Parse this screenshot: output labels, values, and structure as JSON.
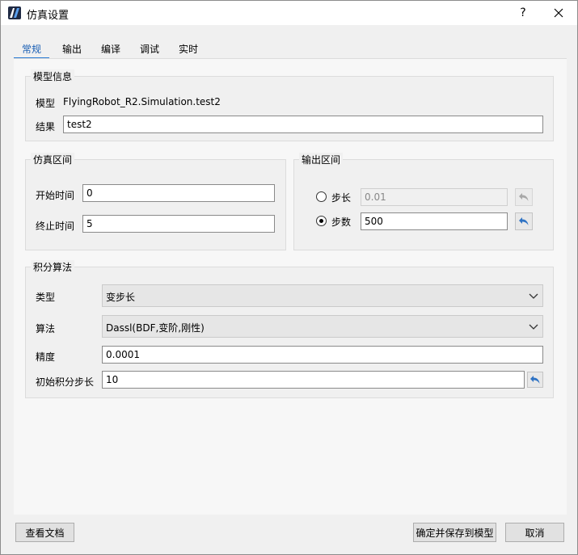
{
  "window": {
    "title": "仿真设置",
    "help_label": "?",
    "close_label": "✕"
  },
  "tabs": [
    {
      "label": "常规"
    },
    {
      "label": "输出"
    },
    {
      "label": "编译"
    },
    {
      "label": "调试"
    },
    {
      "label": "实时"
    }
  ],
  "model_info": {
    "title": "模型信息",
    "model_label": "模型",
    "model_value": "FlyingRobot_R2.Simulation.test2",
    "result_label": "结果",
    "result_value": "test2"
  },
  "sim_interval": {
    "title": "仿真区间",
    "start_label": "开始时间",
    "start_value": "0",
    "stop_label": "终止时间",
    "stop_value": "5"
  },
  "output_interval": {
    "title": "输出区间",
    "step_label": "步长",
    "step_value": "0.01",
    "count_label": "步数",
    "count_value": "500",
    "selected": "步数"
  },
  "integration": {
    "title": "积分算法",
    "type_label": "类型",
    "type_value": "变步长",
    "algorithm_label": "算法",
    "algorithm_value": "Dassl(BDF,变阶,刚性)",
    "precision_label": "精度",
    "precision_value": "0.0001",
    "init_step_label": "初始积分步长",
    "init_step_value": "10"
  },
  "footer": {
    "docs_label": "查看文档",
    "save_label": "确定并保存到模型",
    "cancel_label": "取消"
  },
  "colors": {
    "accent": "#1a5fb4",
    "reset_arrow": "#2f73c4"
  },
  "icons": {
    "app": "app-logo-icon",
    "reset": "undo-arrow-icon",
    "chevron": "chevron-down-icon"
  }
}
